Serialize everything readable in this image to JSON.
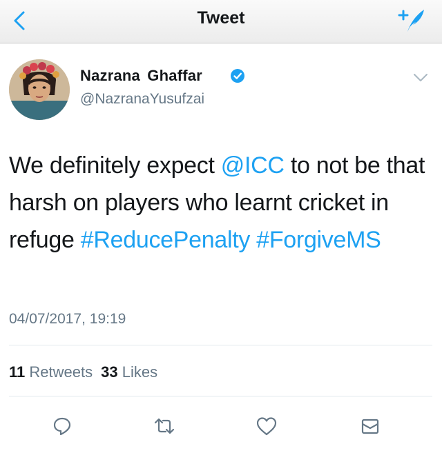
{
  "navbar": {
    "title": "Tweet",
    "back_icon": "chevron-left-icon",
    "compose_icon": "compose-tweet-icon"
  },
  "tweet": {
    "author": {
      "display_name": "Nazrana Ghaffar",
      "handle": "@NazranaYusufzai",
      "verified": true
    },
    "text_segments": [
      {
        "type": "text",
        "value": "We definitely expect "
      },
      {
        "type": "link",
        "value": "@ICC"
      },
      {
        "type": "text",
        "value": " to not be that harsh on players who learnt cricket in refuge "
      },
      {
        "type": "link",
        "value": "#ReducePenalty"
      },
      {
        "type": "text",
        "value": " "
      },
      {
        "type": "link",
        "value": "#ForgiveMS"
      }
    ],
    "timestamp": "04/07/2017, 19:19",
    "stats": {
      "retweets_count": "11",
      "retweets_label": "Retweets",
      "likes_count": "33",
      "likes_label": "Likes"
    },
    "actions": [
      "reply-icon",
      "retweet-icon",
      "like-icon",
      "share-icon"
    ]
  },
  "colors": {
    "link": "#1da1f2",
    "secondary_text": "#657786",
    "primary_text": "#14171a",
    "verified_badge": "#1da1f2"
  }
}
